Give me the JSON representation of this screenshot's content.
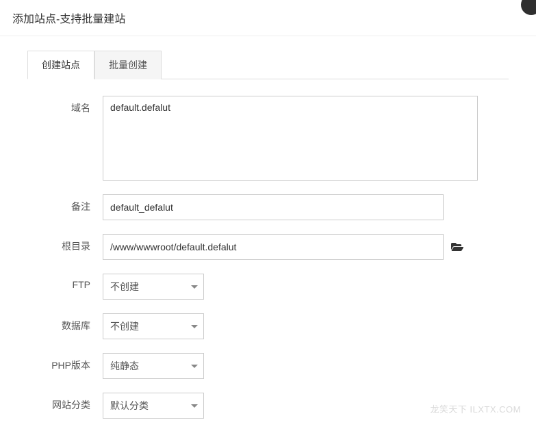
{
  "header": {
    "title": "添加站点-支持批量建站"
  },
  "tabs": {
    "create": "创建站点",
    "batch": "批量创建"
  },
  "form": {
    "domain": {
      "label": "域名",
      "value": "default.defalut"
    },
    "remark": {
      "label": "备注",
      "value": "default_defalut"
    },
    "root": {
      "label": "根目录",
      "value": "/www/wwwroot/default.defalut"
    },
    "ftp": {
      "label": "FTP",
      "value": "不创建"
    },
    "database": {
      "label": "数据库",
      "value": "不创建"
    },
    "php": {
      "label": "PHP版本",
      "value": "纯静态"
    },
    "category": {
      "label": "网站分类",
      "value": "默认分类"
    }
  },
  "watermark": "龙笑天下 ILXTX.COM"
}
